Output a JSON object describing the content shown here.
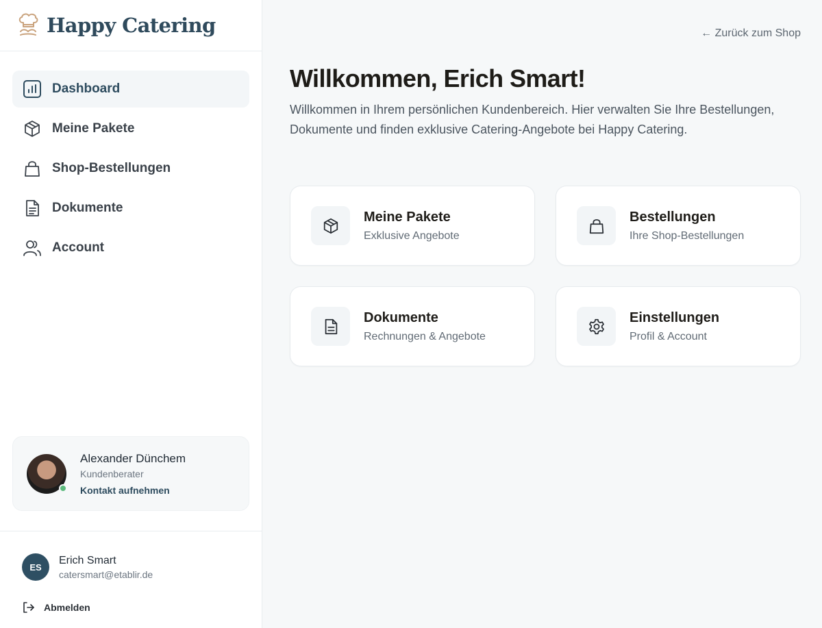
{
  "brand": {
    "name": "Happy Catering"
  },
  "sidebar": {
    "items": [
      {
        "label": "Dashboard",
        "icon": "bar-chart-icon",
        "active": true
      },
      {
        "label": "Meine Pakete",
        "icon": "package-icon",
        "active": false
      },
      {
        "label": "Shop-Bestellungen",
        "icon": "shopping-bag-icon",
        "active": false
      },
      {
        "label": "Dokumente",
        "icon": "document-icon",
        "active": false
      },
      {
        "label": "Account",
        "icon": "users-icon",
        "active": false
      }
    ]
  },
  "advisor": {
    "name": "Alexander Dünchem",
    "role": "Kundenberater",
    "contact_label": "Kontakt aufnehmen",
    "status": "online"
  },
  "user": {
    "initials": "ES",
    "name": "Erich Smart",
    "email": "catersmart@etablir.de",
    "logout_label": "Abmelden"
  },
  "main": {
    "back_link": "← Zurück zum Shop",
    "title": "Willkommen, Erich Smart!",
    "intro": "Willkommen in Ihrem persönlichen Kundenbereich. Hier verwalten Sie Ihre Bestellungen, Dokumente und finden exklusive Catering-Angebote bei Happy Catering.",
    "cards": [
      {
        "title": "Meine Pakete",
        "subtitle": "Exklusive Angebote",
        "icon": "package-icon"
      },
      {
        "title": "Bestellungen",
        "subtitle": "Ihre Shop-Bestellungen",
        "icon": "shopping-bag-icon"
      },
      {
        "title": "Dokumente",
        "subtitle": "Rechnungen & Angebote",
        "icon": "document-icon"
      },
      {
        "title": "Einstellungen",
        "subtitle": "Profil & Account",
        "icon": "settings-icon"
      }
    ]
  },
  "colors": {
    "accent": "#2d4b5e",
    "brand_logo": "#c9a27c",
    "background": "#f6f8f9",
    "online": "#5cba7d"
  }
}
